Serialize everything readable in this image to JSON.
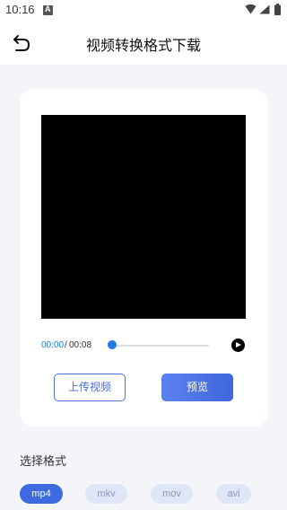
{
  "status_bar": {
    "time": "10:16"
  },
  "header": {
    "title": "视频转换格式下载",
    "back_icon": "back-arrow-icon"
  },
  "player": {
    "current_time": "00:00",
    "separator": "/",
    "total_time": "00:08",
    "progress": 0
  },
  "actions": {
    "upload_label": "上传视频",
    "preview_label": "预览"
  },
  "formats": {
    "label": "选择格式",
    "options": [
      "mp4",
      "mkv",
      "mov",
      "avi"
    ],
    "selected": "mp4"
  },
  "colors": {
    "accent": "#3e6ae0",
    "time_current": "#1e7ae6",
    "background": "#f3f5f9"
  }
}
